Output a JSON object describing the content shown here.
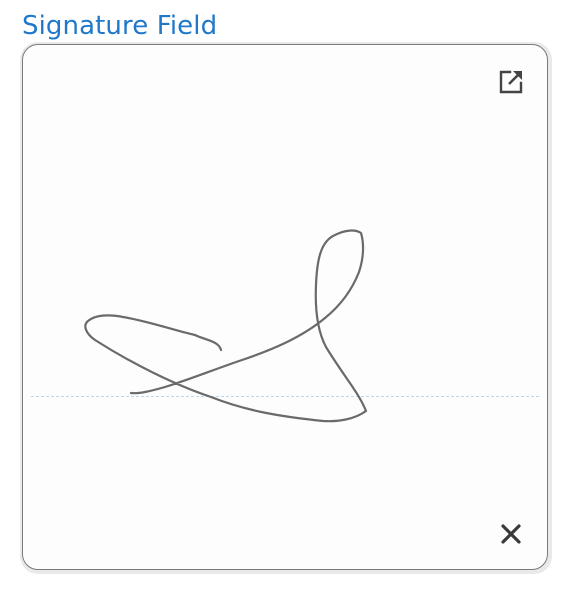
{
  "field": {
    "label": "Signature Field"
  },
  "pad": {
    "expand_icon": "external-link-icon",
    "clear_icon": "close-icon",
    "ink_color": "#6a6a6a",
    "baseline_color": "#b8d8f0",
    "label_color": "#1f78c9"
  }
}
